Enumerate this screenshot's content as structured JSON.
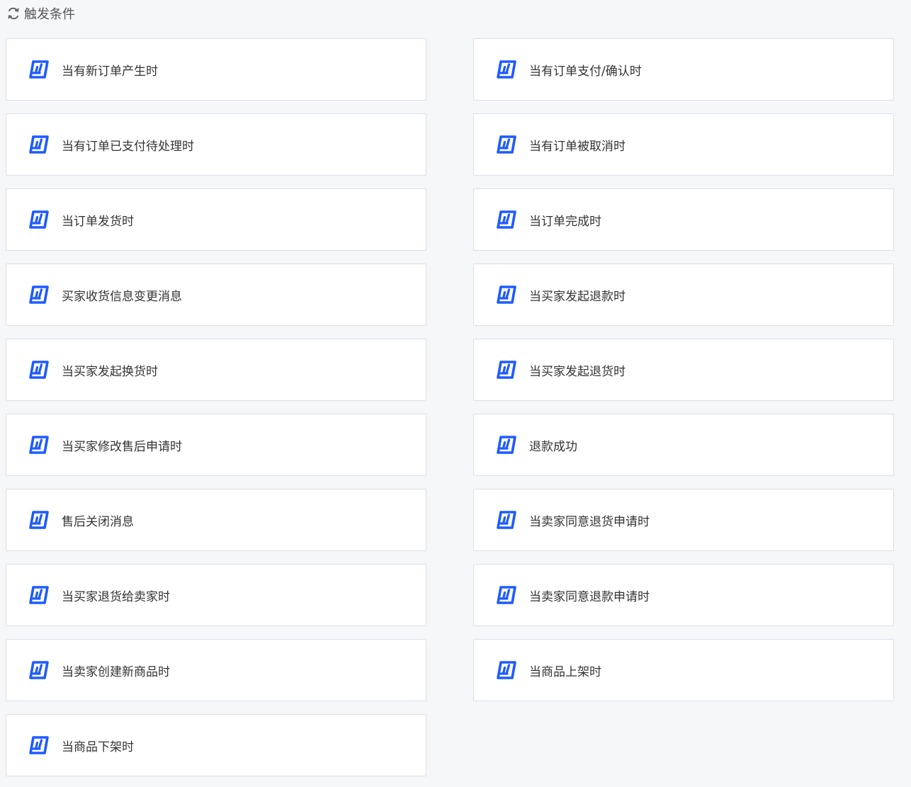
{
  "header": {
    "icon": "refresh-icon",
    "title": "触发条件"
  },
  "colors": {
    "accent": "#1e5bff",
    "background": "#f6f7f9",
    "card_border": "#dcdfe6"
  },
  "cards": [
    {
      "label": "当有新订单产生时",
      "icon": "app-logo-icon"
    },
    {
      "label": "当有订单支付/确认时",
      "icon": "app-logo-icon"
    },
    {
      "label": "当有订单已支付待处理时",
      "icon": "app-logo-icon"
    },
    {
      "label": "当有订单被取消时",
      "icon": "app-logo-icon"
    },
    {
      "label": "当订单发货时",
      "icon": "app-logo-icon"
    },
    {
      "label": "当订单完成时",
      "icon": "app-logo-icon"
    },
    {
      "label": "买家收货信息变更消息",
      "icon": "app-logo-icon"
    },
    {
      "label": "当买家发起退款时",
      "icon": "app-logo-icon"
    },
    {
      "label": "当买家发起换货时",
      "icon": "app-logo-icon"
    },
    {
      "label": "当买家发起退货时",
      "icon": "app-logo-icon"
    },
    {
      "label": "当买家修改售后申请时",
      "icon": "app-logo-icon"
    },
    {
      "label": "退款成功",
      "icon": "app-logo-icon"
    },
    {
      "label": "售后关闭消息",
      "icon": "app-logo-icon"
    },
    {
      "label": "当卖家同意退货申请时",
      "icon": "app-logo-icon"
    },
    {
      "label": "当买家退货给卖家时",
      "icon": "app-logo-icon"
    },
    {
      "label": "当卖家同意退款申请时",
      "icon": "app-logo-icon"
    },
    {
      "label": "当卖家创建新商品时",
      "icon": "app-logo-icon"
    },
    {
      "label": "当商品上架时",
      "icon": "app-logo-icon"
    },
    {
      "label": "当商品下架时",
      "icon": "app-logo-icon"
    }
  ]
}
